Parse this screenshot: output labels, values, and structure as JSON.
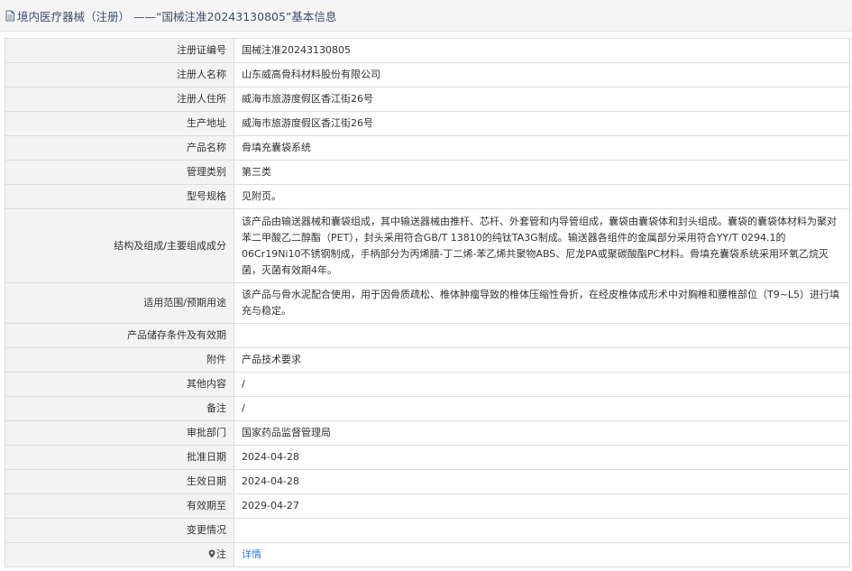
{
  "header": {
    "title": "境内医疗器械（注册） ——“国械注准20243130805”基本信息"
  },
  "rows": [
    {
      "label": "注册证编号",
      "value": "国械注准20243130805"
    },
    {
      "label": "注册人名称",
      "value": "山东威高骨科材料股份有限公司"
    },
    {
      "label": "注册人住所",
      "value": "威海市旅游度假区香江街26号"
    },
    {
      "label": "生产地址",
      "value": "威海市旅游度假区香江街26号"
    },
    {
      "label": "产品名称",
      "value": "骨填充囊袋系统"
    },
    {
      "label": "管理类别",
      "value": "第三类"
    },
    {
      "label": "型号规格",
      "value": "见附页。"
    },
    {
      "label": "结构及组成/主要组成成分",
      "value": "该产品由输送器械和囊袋组成，其中输送器械由推杆、芯杆、外套管和内导管组成，囊袋由囊袋体和封头组成。囊袋的囊袋体材料为聚对苯二甲酸乙二醇酯（PET），封头采用符合GB/T 13810的纯钛TA3G制成。输送器各组件的金属部分采用符合YY/T 0294.1的06Cr19Ni10不锈钢制成，手柄部分为丙烯腈-丁二烯-苯乙烯共聚物ABS、尼龙PA或聚碳酸酯PC材料。骨填充囊袋系统采用环氧乙烷灭菌，灭菌有效期4年。"
    },
    {
      "label": "适用范围/预期用途",
      "value": "该产品与骨水泥配合使用，用于因骨质疏松、椎体肿瘤导致的椎体压缩性骨折，在经皮椎体成形术中对胸椎和腰椎部位（T9~L5）进行填充与稳定。"
    },
    {
      "label": "产品储存条件及有效期",
      "value": ""
    },
    {
      "label": "附件",
      "value": "产品技术要求"
    },
    {
      "label": "其他内容",
      "value": "/"
    },
    {
      "label": "备注",
      "value": "/"
    },
    {
      "label": "审批部门",
      "value": "国家药品监督管理局"
    },
    {
      "label": "批准日期",
      "value": "2024-04-28"
    },
    {
      "label": "生效日期",
      "value": "2024-04-28"
    },
    {
      "label": "有效期至",
      "value": "2029-04-27"
    },
    {
      "label": "变更情况",
      "value": ""
    }
  ],
  "last_row": {
    "label": "注",
    "link_text": "详情",
    "icon": "map-pin-icon"
  },
  "colors": {
    "label_bg": "#f3f3f3",
    "border": "#dddddd",
    "link": "#2d7bd6",
    "header_text": "#3f4d6d"
  }
}
